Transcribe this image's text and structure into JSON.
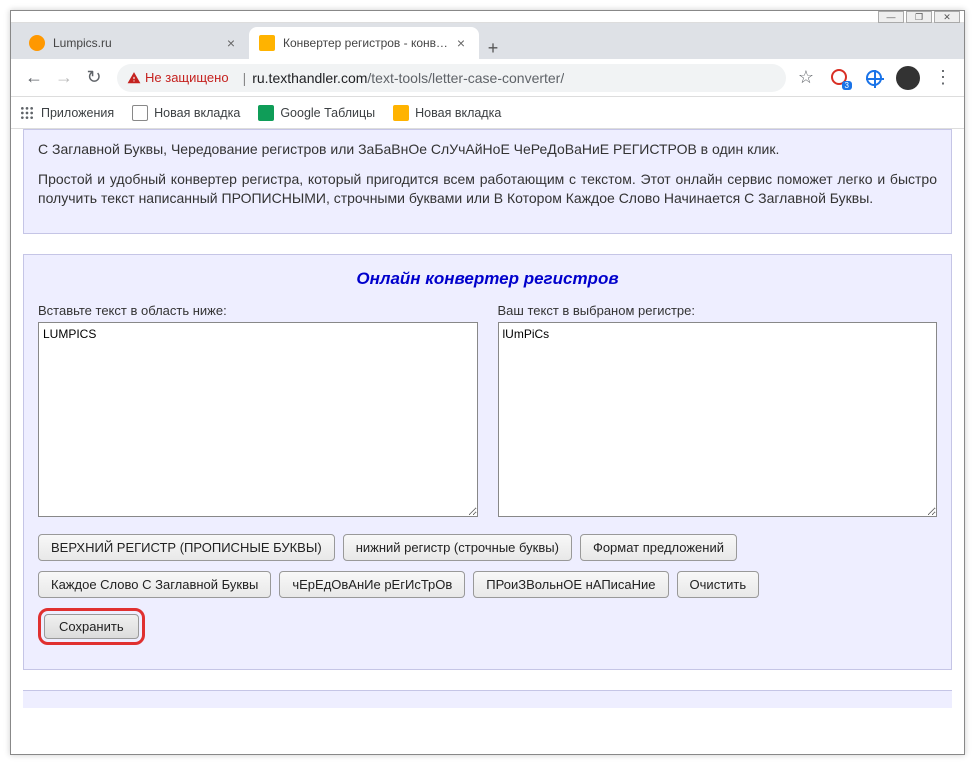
{
  "window": {
    "minimize": "—",
    "maximize": "❐",
    "close": "✕"
  },
  "tabs": [
    {
      "title": "Lumpics.ru",
      "active": false
    },
    {
      "title": "Конвертер регистров - конверт",
      "active": true
    }
  ],
  "newtab": "+",
  "nav": {
    "back": "←",
    "forward": "→",
    "reload": "↻"
  },
  "security": {
    "label": "Не защищено"
  },
  "url": {
    "host": "ru.texthandler.com",
    "path": "/text-tools/letter-case-converter/"
  },
  "ext_badge": "3",
  "menu": "⋮",
  "bookmarks": [
    {
      "label": "Приложения",
      "icon": "apps"
    },
    {
      "label": "Новая вкладка",
      "icon": "doc"
    },
    {
      "label": "Google Таблицы",
      "icon": "sheets"
    },
    {
      "label": "Новая вкладка",
      "icon": "th"
    }
  ],
  "description": {
    "p1": "С Заглавной Буквы, Чередование регистров или ЗаБаВнОе СлУчАйНоЕ ЧеРеДоВаНиЕ РЕГИСТРОВ в один клик.",
    "p2": "Простой и удобный конвертер регистра, который пригодится всем работающим с текстом. Этот онлайн сервис поможет легко и быстро получить текст написанный ПРОПИСНЫМИ, строчными буквами или В Котором Каждое Слово Начинается С Заглавной Буквы."
  },
  "converter": {
    "title": "Онлайн конвертер регистров",
    "input_label": "Вставьте текст в область ниже:",
    "output_label": "Ваш текст в выбраном регистре:",
    "input_value": "LUMPICS",
    "output_value": "lUmPiCs",
    "buttons_row1": [
      "ВЕРХНИЙ РЕГИСТР (ПРОПИСНЫЕ БУКВЫ)",
      "нижний регистр (строчные буквы)",
      "Формат предложений"
    ],
    "buttons_row2": [
      "Каждое Слово С Заглавной Буквы",
      "чЕрЕдОвАнИе рЕгИсТрОв",
      "ПРоиЗВольнОЕ нАПисаНие",
      "Очистить"
    ],
    "save": "Сохранить"
  }
}
